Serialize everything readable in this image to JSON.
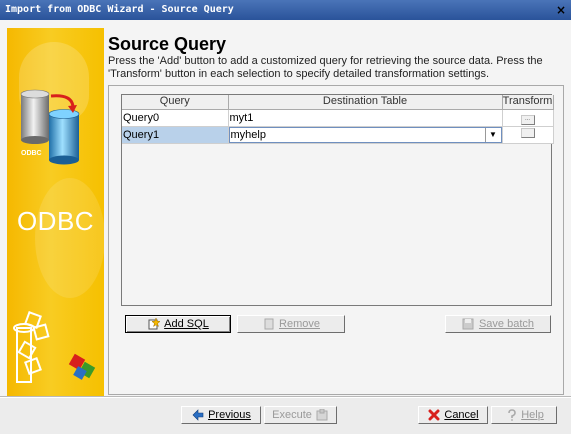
{
  "window": {
    "title": "Import from ODBC Wizard - Source Query",
    "close_glyph": "×"
  },
  "banner": {
    "label": "ODBC",
    "small_label": "ODBC"
  },
  "header": {
    "title": "Source Query",
    "description": "Press the 'Add' button to add a customized query for retrieving the source data. Press the 'Transform' button in each selection to specify detailed transformation settings."
  },
  "grid": {
    "columns": [
      "Query",
      "Destination Table",
      "Transform"
    ],
    "rows": [
      {
        "query": "Query0",
        "destination": "myt1",
        "transform_glyph": "..."
      },
      {
        "query": "Query1",
        "destination": "myhelp",
        "transform_glyph": ""
      }
    ],
    "selected_row": 1
  },
  "panel_buttons": {
    "add_sql": {
      "label": "Add SQL",
      "mnemonic": "A",
      "icon": "add-sql-icon"
    },
    "remove": {
      "label": "Remove",
      "mnemonic": "R",
      "icon": "remove-icon"
    },
    "save_batch": {
      "label": "Save batch",
      "mnemonic": "S",
      "icon": "save-batch-icon"
    }
  },
  "footer_buttons": {
    "previous": {
      "label": "Previous",
      "icon": "arrow-left-icon"
    },
    "execute": {
      "label": "Execute",
      "icon": "execute-icon"
    },
    "cancel": {
      "label": "Cancel",
      "icon": "cancel-icon"
    },
    "help": {
      "label": "Help",
      "icon": "help-icon"
    }
  },
  "colors": {
    "title_bar": "#2f5aa0",
    "banner": "#f6c000",
    "selected_row": "#b9d1ea",
    "cancel_icon": "#d8201c"
  }
}
